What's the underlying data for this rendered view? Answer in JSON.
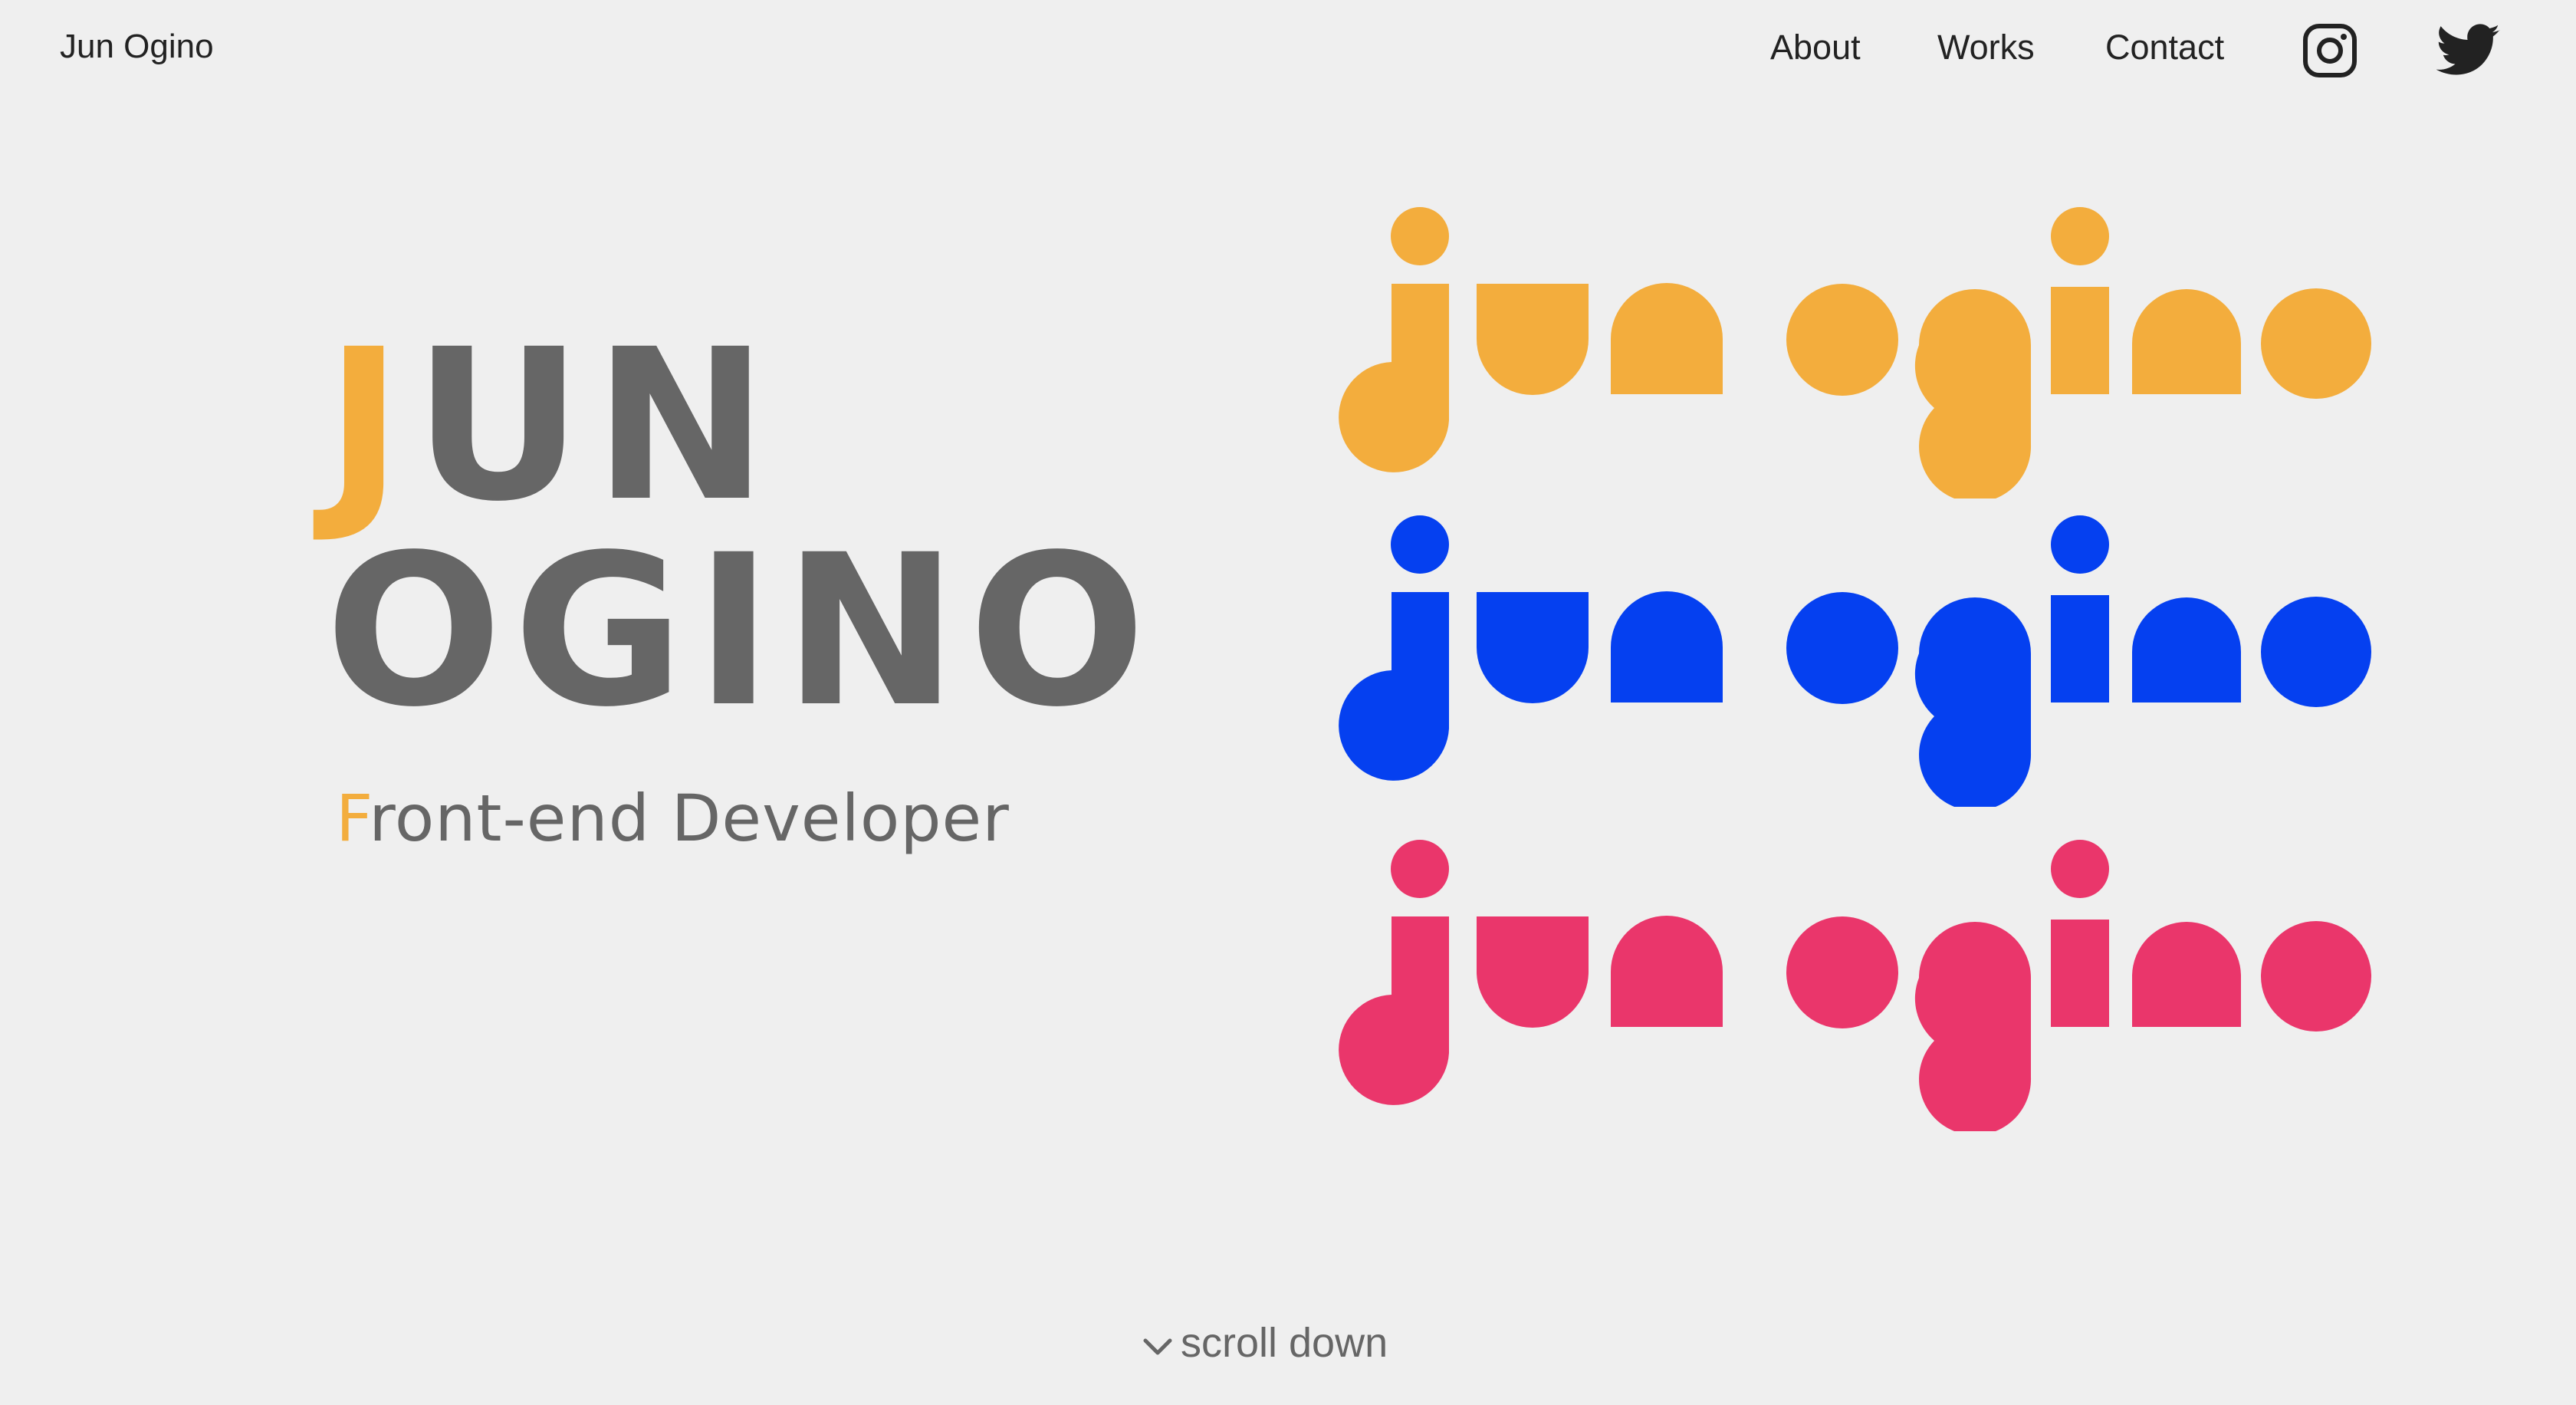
{
  "header": {
    "site_name": "Jun Ogino",
    "nav": [
      {
        "label": "About"
      },
      {
        "label": "Works"
      },
      {
        "label": "Contact"
      }
    ],
    "social_icons": [
      "instagram-icon",
      "twitter-icon"
    ]
  },
  "hero": {
    "line1_accent": "J",
    "line1_rest": "UN",
    "line2": "OGINO",
    "subtitle_accent": "F",
    "subtitle_rest": "ront-end Developer"
  },
  "logos": {
    "text": "jun ogino",
    "colors": [
      "#f3ad3d",
      "#0540f0",
      "#ea366b"
    ]
  },
  "scroll": {
    "label": "scroll down",
    "icon": "chevron-down-icon"
  },
  "colors": {
    "background": "#efefef",
    "text_dark": "#222222",
    "text_gray": "#666666",
    "accent": "#f3ad3d"
  }
}
